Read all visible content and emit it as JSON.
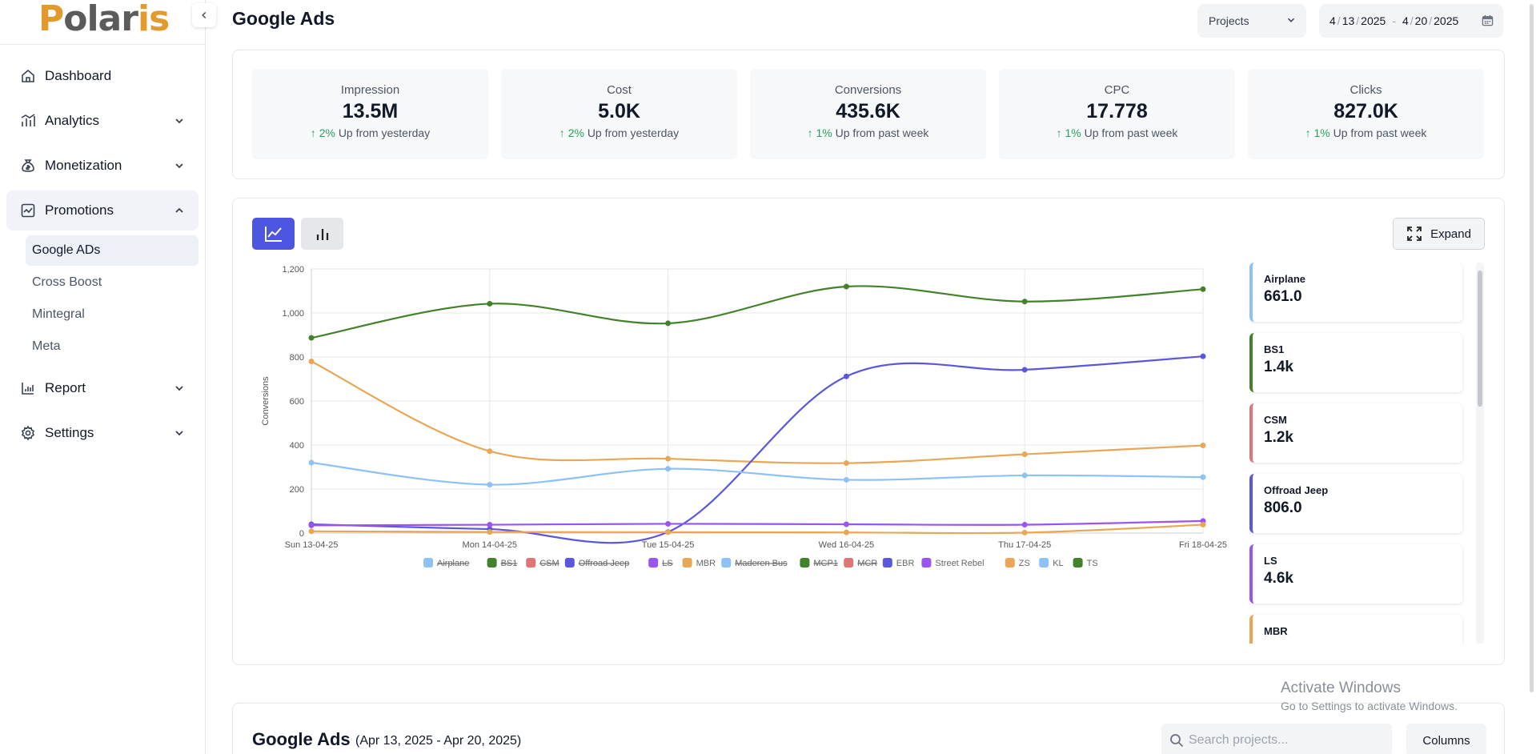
{
  "sidebar": {
    "logo": {
      "part1": "P",
      "part2": "olar",
      "part3": "is"
    },
    "nav": [
      {
        "label": "Dashboard",
        "icon": "home-icon"
      },
      {
        "label": "Analytics",
        "icon": "bar-chart-icon"
      },
      {
        "label": "Monetization",
        "icon": "money-bag-icon"
      },
      {
        "label": "Promotions",
        "icon": "promotions-chart-icon"
      },
      {
        "label": "Report",
        "icon": "report-icon"
      },
      {
        "label": "Settings",
        "icon": "gear-icon"
      }
    ],
    "promotions_sub": [
      "Google ADs",
      "Cross Boost",
      "Mintegral",
      "Meta"
    ],
    "active_sub": "Google ADs"
  },
  "header": {
    "title": "Google Ads",
    "projects_label": "Projects",
    "date_start": {
      "m": "4",
      "d": "13",
      "y": "2025"
    },
    "date_end": {
      "m": "4",
      "d": "20",
      "y": "2025"
    }
  },
  "stats": [
    {
      "label": "Impression",
      "value": "13.5M",
      "delta": "2%",
      "note": "Up from yesterday"
    },
    {
      "label": "Cost",
      "value": "5.0K",
      "delta": "2%",
      "note": "Up from yesterday"
    },
    {
      "label": "Conversions",
      "value": "435.6K",
      "delta": "1%",
      "note": "Up from past week"
    },
    {
      "label": "CPC",
      "value": "17.778",
      "delta": "1%",
      "note": "Up from past week"
    },
    {
      "label": "Clicks",
      "value": "827.0K",
      "delta": "1%",
      "note": "Up from past week"
    }
  ],
  "chart_toolbar": {
    "expand_label": "Expand"
  },
  "chart_data": {
    "type": "line",
    "ylabel": "Conversions",
    "ylim": [
      0,
      1200
    ],
    "yticks": [
      "0",
      "200",
      "400",
      "600",
      "800",
      "1,000",
      "1,200"
    ],
    "categories": [
      "Sun 13-04-25",
      "Mon 14-04-25",
      "Tue 15-04-25",
      "Wed 16-04-25",
      "Thu 17-04-25",
      "Fri 18-04-25"
    ],
    "grid": true,
    "legend_position": "bottom",
    "series": [
      {
        "name": "Airplane",
        "color": "#8ec1f5",
        "hidden": true,
        "values": []
      },
      {
        "name": "BS1",
        "color": "#43822a",
        "hidden": true,
        "values": []
      },
      {
        "name": "CSM",
        "color": "#e07575",
        "hidden": true,
        "values": []
      },
      {
        "name": "Offroad Jeep",
        "color": "#5b57dc",
        "hidden": true,
        "values": []
      },
      {
        "name": "LS",
        "color": "#9a54ef",
        "hidden": true,
        "values": []
      },
      {
        "name": "MBR",
        "color": "#e9a755",
        "hidden": false,
        "values": [
          780,
          372,
          338,
          318,
          358,
          398
        ]
      },
      {
        "name": "Maderen Bus",
        "color": "#8ec1f5",
        "hidden": true,
        "values": []
      },
      {
        "name": "MCP1",
        "color": "#43822a",
        "hidden": true,
        "values": []
      },
      {
        "name": "MCR",
        "color": "#e07575",
        "hidden": true,
        "values": []
      },
      {
        "name": "EBR",
        "color": "#5b57dc",
        "hidden": false,
        "values": [
          40,
          18,
          5,
          712,
          742,
          803
        ]
      },
      {
        "name": "Street Rebel",
        "color": "#9a54ef",
        "hidden": false,
        "values": [
          35,
          38,
          42,
          40,
          38,
          55
        ]
      },
      {
        "name": "ZS",
        "color": "#e9a755",
        "hidden": false,
        "values": [
          8,
          5,
          4,
          3,
          2,
          38
        ]
      },
      {
        "name": "KL",
        "color": "#8ec1f5",
        "hidden": false,
        "values": [
          320,
          220,
          292,
          242,
          262,
          254
        ]
      },
      {
        "name": "TS",
        "color": "#43822a",
        "hidden": false,
        "values": [
          887,
          1042,
          953,
          1120,
          1052,
          1108
        ]
      }
    ]
  },
  "series_cards": [
    {
      "name": "Airplane",
      "value": "661.0",
      "color": "#8ec1f5"
    },
    {
      "name": "BS1",
      "value": "1.4k",
      "color": "#43822a"
    },
    {
      "name": "CSM",
      "value": "1.2k",
      "color": "#e07575"
    },
    {
      "name": "Offroad Jeep",
      "value": "806.0",
      "color": "#5b57dc"
    },
    {
      "name": "LS",
      "value": "4.6k",
      "color": "#9a54ef"
    },
    {
      "name": "MBR",
      "value": "",
      "color": "#e9a755"
    }
  ],
  "table": {
    "title": "Google Ads",
    "range": "(Apr 13, 2025 - Apr 20, 2025)",
    "search_placeholder": "Search projects...",
    "columns_label": "Columns"
  },
  "watermark": {
    "line1": "Activate Windows",
    "line2": "Go to Settings to activate Windows."
  }
}
